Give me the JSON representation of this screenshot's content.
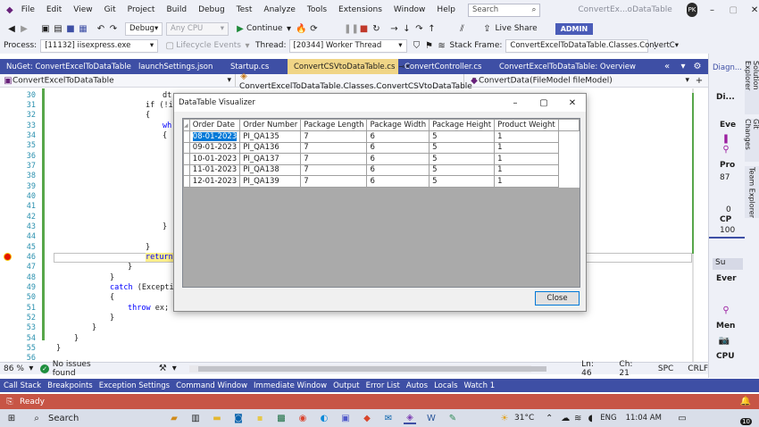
{
  "menu": {
    "items": [
      "File",
      "Edit",
      "View",
      "Git",
      "Project",
      "Build",
      "Debug",
      "Test",
      "Analyze",
      "Tools",
      "Extensions",
      "Window",
      "Help"
    ],
    "search_placeholder": "Search",
    "window_title": "ConvertEx...oDataTable",
    "avatar": "PK",
    "admin": "ADMIN"
  },
  "toolbar": {
    "config": "Debug",
    "platform": "Any CPU",
    "continue_label": "Continue",
    "live_share": "Live Share"
  },
  "debugbar": {
    "process_label": "Process:",
    "process_value": "[11132] iisexpress.exe",
    "lifecycle": "Lifecycle Events",
    "thread_label": "Thread:",
    "thread_value": "[20344] Worker Thread",
    "stack_label": "Stack Frame:",
    "stack_value": "ConvertExcelToDataTable.Classes.ConvertC"
  },
  "tabs": [
    "NuGet: ConvertExcelToDataTable",
    "launchSettings.json",
    "Startup.cs",
    "ConvertCSVtoDataTable.cs",
    "ConvertController.cs",
    "ConvertExcelToDataTable: Overview"
  ],
  "nav": {
    "project": "ConvertExcelToDataTable",
    "class": "ConvertExcelToDataTable.Classes.ConvertCSVtoDataTable",
    "member": "ConvertData(FileModel fileModel)"
  },
  "line_numbers": [
    "30",
    "31",
    "32",
    "33",
    "34",
    "35",
    "36",
    "37",
    "38",
    "39",
    "40",
    "41",
    "42",
    "43",
    "44",
    "45",
    "46",
    "47",
    "48",
    "49",
    "50",
    "51",
    "52",
    "53",
    "54",
    "55",
    "56"
  ],
  "code": {
    "l30": "dt",
    "l31": "if (!is",
    "l32": "{",
    "l33": "wh",
    "l34": "{",
    "l43": "}",
    "l45": "}",
    "l46": "return",
    "l47": "}",
    "l48": "}",
    "l49_kw": "catch",
    "l49_rest": " (Excepti",
    "l50": "{",
    "l51_kw": "throw",
    "l51_rest": " ex;",
    "l52": "}",
    "l53": "}",
    "l54": "}",
    "l55": "}"
  },
  "statusline": {
    "zoom": "86 %",
    "issues": "No issues found",
    "ln": "Ln: 46",
    "ch": "Ch: 21",
    "spc": "SPC",
    "crlf": "CRLF"
  },
  "bottom_tabs": [
    "Call Stack",
    "Breakpoints",
    "Exception Settings",
    "Command Window",
    "Immediate Window",
    "Output",
    "Error List",
    "Autos",
    "Locals",
    "Watch 1"
  ],
  "vs_status": "Ready",
  "right_panel": {
    "title": "Diagn...",
    "vtabs": [
      "Solution Explorer",
      "Git Changes",
      "Team Explorer"
    ],
    "fragments": [
      "Di...",
      "Eve",
      "Pro",
      "87",
      "0",
      "CP",
      "100",
      "Su",
      "Ever",
      "Men",
      "CPU"
    ]
  },
  "dialog": {
    "title": "DataTable Visualizer",
    "close_label": "Close",
    "columns": [
      "Order Date",
      "Order Number",
      "Package Length",
      "Package Width",
      "Package Height",
      "Product Weight"
    ],
    "rows": [
      [
        "08-01-2023",
        "PI_QA135",
        "7",
        "6",
        "5",
        "1"
      ],
      [
        "09-01-2023",
        "PI_QA136",
        "7",
        "6",
        "5",
        "1"
      ],
      [
        "10-01-2023",
        "PI_QA137",
        "7",
        "6",
        "5",
        "1"
      ],
      [
        "11-01-2023",
        "PI_QA138",
        "7",
        "6",
        "5",
        "1"
      ],
      [
        "12-01-2023",
        "PI_QA139",
        "7",
        "6",
        "5",
        "1"
      ]
    ]
  },
  "taskbar": {
    "search": "Search",
    "temp": "31°C",
    "lang": "ENG",
    "time": "11:04 AM",
    "notif": "10"
  },
  "colors": {
    "accent": "#3e4fa5",
    "status": "#c75545",
    "active_tab": "#f0d586",
    "selection": "#0078d7"
  }
}
